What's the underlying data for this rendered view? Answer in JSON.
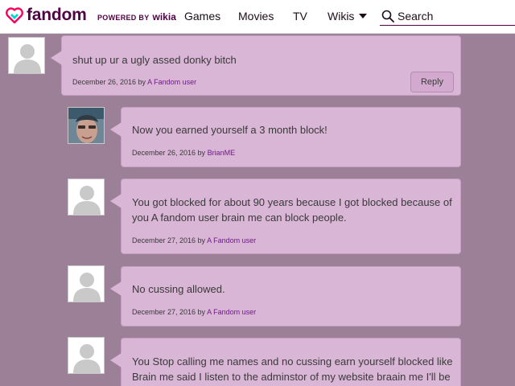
{
  "header": {
    "logo_text": "fandom",
    "powered_by": "POWERED BY",
    "powered_brand": "wikia",
    "nav": [
      "Games",
      "Movies",
      "TV",
      "Wikis"
    ],
    "search_label": "Search"
  },
  "comments": [
    {
      "text": "shut up ur a ugly assed donky bitch",
      "date": "December 26, 2016 by ",
      "user": "A Fandom user",
      "reply_label": "Reply"
    },
    {
      "text": "Now you earned yourself a 3 month block!",
      "date": "December 26, 2016 by ",
      "user": "BrianME"
    },
    {
      "text_line1": "You got blocked for about 90 years because I got blocked because of",
      "text_line2": "you A fandom user brain me can block people.",
      "date": "December 27, 2016 by ",
      "user": "A Fandom user"
    },
    {
      "text": "No cussing allowed.",
      "date": "December 27, 2016 by ",
      "user": "A Fandom user"
    },
    {
      "text_line1": "You Stop calling me names and no cussing earn yourself blocked like",
      "text_line2": "Brain me said I listen to the adminstor of my website braain me I'll be the"
    }
  ],
  "colors": {
    "page_bg": "#9b8097",
    "bubble_bg": "#d9b5d6",
    "brand": "#520044",
    "username_link": "#6e1b86"
  }
}
